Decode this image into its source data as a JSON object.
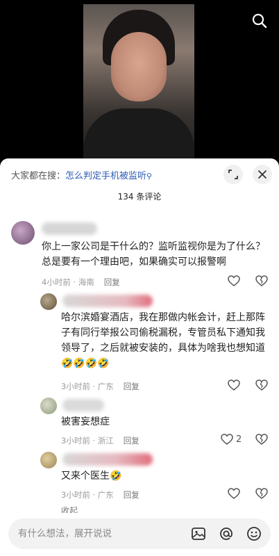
{
  "header": {
    "search_prefix": "大家都在搜：",
    "search_query": "怎么判定手机被监听",
    "comment_count": "134 条评论"
  },
  "comments": [
    {
      "text": "你上一家公司是干什么的？监听监视你是为了什么？总是要有一个理由吧，如果确实可以报警啊",
      "meta": "4小时前 · 海南",
      "reply": "回复",
      "likes": ""
    },
    {
      "text": "哈尔滨婚宴酒店，我在那做内帐会计，赶上那阵子有同行举报公司偷税漏税，专管员私下通知我领导了，之后就被安装的，具体为啥我也想知道🤣🤣🤣🤣",
      "meta": "3小时前 · 广东",
      "reply": "回复",
      "likes": ""
    },
    {
      "text": "被害妄想症",
      "meta": "3小时前 · 浙江",
      "reply": "回复",
      "likes": "2"
    },
    {
      "text": "又来个医生🤣",
      "meta": "3小时前 · 广东",
      "reply": "回复",
      "likes": ""
    }
  ],
  "collapse_label": "收起",
  "footer": {
    "input_placeholder": "有什么想法，展开说说"
  },
  "icons": [
    "search-icon",
    "expand-icon",
    "close-icon",
    "heart-icon",
    "dislike-icon",
    "image-icon",
    "at-icon",
    "emoji-icon"
  ]
}
